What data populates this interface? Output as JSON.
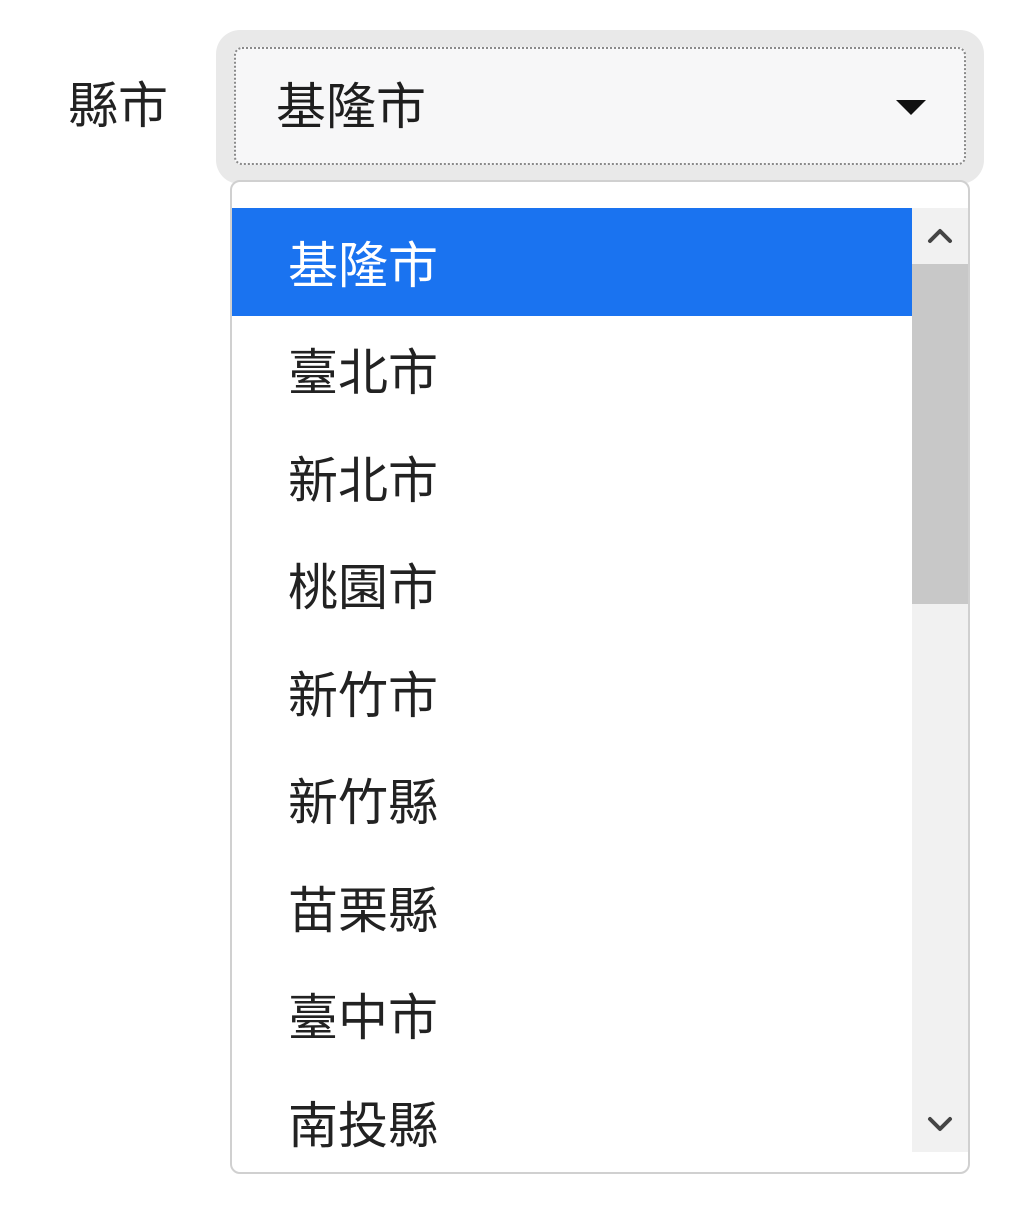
{
  "form": {
    "label": "縣市",
    "select": {
      "selected_value": "基隆市"
    }
  },
  "dropdown": {
    "options": [
      {
        "label": "基隆市",
        "selected": true
      },
      {
        "label": "臺北市",
        "selected": false
      },
      {
        "label": "新北市",
        "selected": false
      },
      {
        "label": "桃園市",
        "selected": false
      },
      {
        "label": "新竹市",
        "selected": false
      },
      {
        "label": "新竹縣",
        "selected": false
      },
      {
        "label": "苗栗縣",
        "selected": false
      },
      {
        "label": "臺中市",
        "selected": false
      },
      {
        "label": "南投縣",
        "selected": false
      }
    ]
  },
  "colors": {
    "selected_option_bg": "#1a73f0",
    "selected_option_text": "#ffffff",
    "scrollbar_thumb": "#c8c8c8"
  },
  "icons": {
    "select_caret": "caret-down-icon",
    "scroll_up": "chevron-up-icon",
    "scroll_down": "chevron-down-icon"
  }
}
